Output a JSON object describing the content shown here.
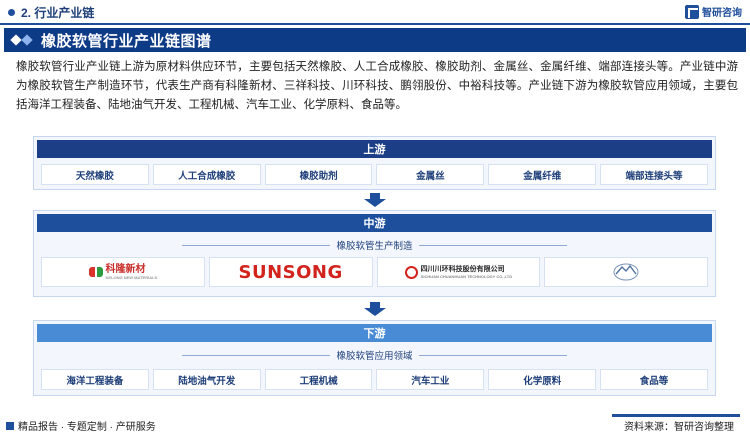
{
  "section": {
    "label": "2. 行业产业链"
  },
  "brand": {
    "name": "智研咨询"
  },
  "banner": {
    "title": "橡胶软管行业产业链图谱"
  },
  "intro": "橡胶软管行业产业链上游为原材料供应环节，主要包括天然橡胶、人工合成橡胶、橡胶助剂、金属丝、金属纤维、端部连接头等。产业链中游为橡胶软管生产制造环节，代表生产商有科隆新材、三祥科技、川环科技、鹏翎股份、中裕科技等。产业链下游为橡胶软管应用领域，主要包括海洋工程装备、陆地油气开发、工程机械、汽车工业、化学原料、食品等。",
  "upstream": {
    "title": "上游",
    "items": [
      "天然橡胶",
      "人工合成橡胶",
      "橡胶助剂",
      "金属丝",
      "金属纤维",
      "端部连接头等"
    ]
  },
  "midstream": {
    "title": "中游",
    "subtitle": "橡胶软管生产制造",
    "logos": [
      {
        "name": "科隆新材",
        "sub": "KELONG NEW MATERIALS",
        "icon": "kelong-logo"
      },
      {
        "name": "SUNSONG",
        "icon": "sunsong-logo"
      },
      {
        "name": "四川川环科技股份有限公司",
        "sub": "SICHUAN CHUANHUAN TECHNOLOGY CO.,LTD",
        "icon": "chuanhuan-logo"
      },
      {
        "name": "",
        "icon": "mountain-logo"
      }
    ]
  },
  "downstream": {
    "title": "下游",
    "subtitle": "橡胶软管应用领域",
    "items": [
      "海洋工程装备",
      "陆地油气开发",
      "工程机械",
      "汽车工业",
      "化学原料",
      "食品等"
    ]
  },
  "footer": {
    "left": "精品报告 · 专题定制 · 产研服务",
    "source": "资料来源：智研咨询整理"
  },
  "colors": {
    "primary": "#0e3b86",
    "mid": "#1d4f9d",
    "light": "#4a8bd6",
    "accent_red": "#d2231d"
  }
}
